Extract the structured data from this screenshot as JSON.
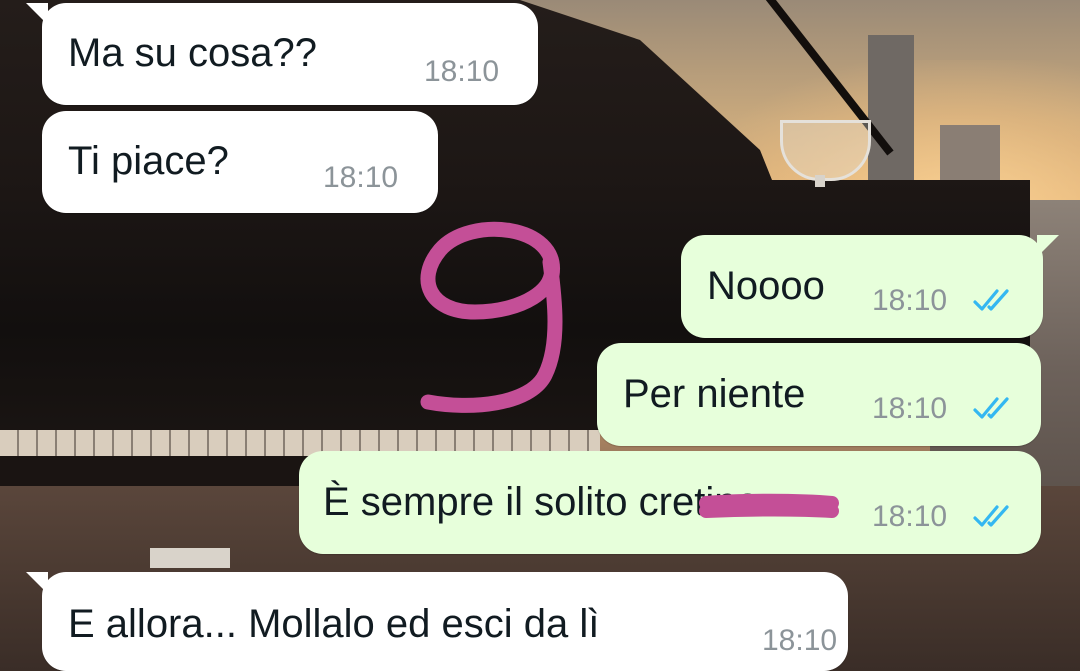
{
  "colors": {
    "incoming_bubble": "#ffffff",
    "outgoing_bubble": "#e7ffdb",
    "text": "#111b21",
    "timestamp": "#8c9499",
    "read_ticks": "#34b7f1",
    "scribble": "#c44f97"
  },
  "messages": [
    {
      "direction": "incoming",
      "text": "Ma su cosa??",
      "time": "18:10"
    },
    {
      "direction": "incoming",
      "text": "Ti piace?",
      "time": "18:10"
    },
    {
      "direction": "outgoing",
      "text": "Noooo",
      "time": "18:10",
      "status_icon": "double-check-read-icon"
    },
    {
      "direction": "outgoing",
      "text": "Per niente",
      "time": "18:10",
      "status_icon": "double-check-read-icon"
    },
    {
      "direction": "outgoing",
      "text": "È sempre il solito cretino",
      "time": "18:10",
      "status_icon": "double-check-read-icon",
      "redacted_word_scribbled": true
    },
    {
      "direction": "incoming",
      "text": "E allora... Mollalo ed esci da lì",
      "time": "18:10"
    }
  ],
  "annotations": [
    {
      "type": "handwritten-scribble",
      "glyph": "9"
    },
    {
      "type": "redaction-scribble"
    }
  ]
}
